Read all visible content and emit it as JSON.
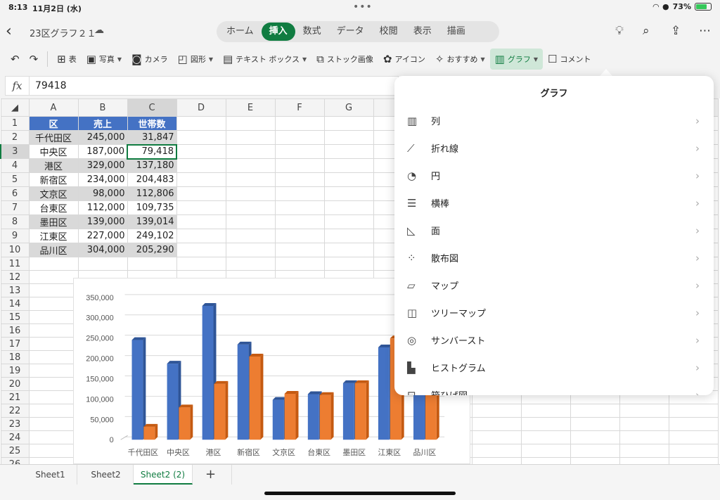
{
  "status": {
    "time": "8:13",
    "date": "11月2日 (水)",
    "battery": "73%",
    "battery_level": 0.73
  },
  "title": {
    "doc": "23区グラフ２１"
  },
  "tabs": [
    "ホーム",
    "挿入",
    "数式",
    "データ",
    "校閲",
    "表示",
    "描画"
  ],
  "active_tab": 1,
  "ribbon": {
    "table": "表",
    "photo": "写真",
    "camera": "カメラ",
    "shapes": "図形",
    "textbox": "テキスト ボックス",
    "stock": "ストック画像",
    "icon": "アイコン",
    "recommend": "おすすめ",
    "chart": "グラフ",
    "comment": "コメント"
  },
  "formula": {
    "fx": "fx",
    "value": "79418"
  },
  "columns": [
    "A",
    "B",
    "C",
    "D",
    "E",
    "F",
    "G"
  ],
  "headers": [
    "区",
    "売上",
    "世帯数"
  ],
  "rows": [
    [
      "千代田区",
      "245,000",
      "31,847"
    ],
    [
      "中央区",
      "187,000",
      "79,418"
    ],
    [
      "港区",
      "329,000",
      "137,180"
    ],
    [
      "新宿区",
      "234,000",
      "204,483"
    ],
    [
      "文京区",
      "98,000",
      "112,806"
    ],
    [
      "台東区",
      "112,000",
      "109,735"
    ],
    [
      "墨田区",
      "139,000",
      "139,014"
    ],
    [
      "江東区",
      "227,000",
      "249,102"
    ],
    [
      "品川区",
      "304,000",
      "205,290"
    ]
  ],
  "row_numbers": [
    "1",
    "2",
    "3",
    "4",
    "5",
    "6",
    "7",
    "8",
    "9",
    "10",
    "11",
    "12",
    "13",
    "14",
    "15",
    "16",
    "17",
    "18",
    "19",
    "20",
    "21",
    "22",
    "23",
    "24",
    "25",
    "26"
  ],
  "chart_data": {
    "type": "bar",
    "categories": [
      "千代田区",
      "中央区",
      "港区",
      "新宿区",
      "文京区",
      "台東区",
      "墨田区",
      "江東区",
      "品川区"
    ],
    "series": [
      {
        "values": [
          245000,
          187000,
          329000,
          234000,
          98000,
          112000,
          139000,
          227000,
          304000
        ],
        "color": "#4472c4"
      },
      {
        "values": [
          31847,
          79418,
          137180,
          204483,
          112806,
          109735,
          139014,
          249102,
          205290
        ],
        "color": "#ed7d31"
      }
    ],
    "yticks": [
      "0",
      "50,000",
      "100,000",
      "150,000",
      "200,000",
      "250,000",
      "300,000",
      "350,000"
    ],
    "ylim": [
      0,
      350000
    ],
    "grid": true
  },
  "dropdown": {
    "title": "グラフ",
    "items": [
      {
        "label": "列",
        "icon": "column-chart-icon",
        "glyph": "▥"
      },
      {
        "label": "折れ線",
        "icon": "line-chart-icon",
        "glyph": "⟋"
      },
      {
        "label": "円",
        "icon": "pie-chart-icon",
        "glyph": "◔"
      },
      {
        "label": "横棒",
        "icon": "bar-chart-icon",
        "glyph": "☰"
      },
      {
        "label": "面",
        "icon": "area-chart-icon",
        "glyph": "◺"
      },
      {
        "label": "散布図",
        "icon": "scatter-chart-icon",
        "glyph": "⁘"
      },
      {
        "label": "マップ",
        "icon": "map-icon",
        "glyph": "▱"
      },
      {
        "label": "ツリーマップ",
        "icon": "treemap-icon",
        "glyph": "◫"
      },
      {
        "label": "サンバースト",
        "icon": "sunburst-icon",
        "glyph": "◎"
      },
      {
        "label": "ヒストグラム",
        "icon": "histogram-icon",
        "glyph": "▙"
      },
      {
        "label": "箱ひげ図",
        "icon": "boxplot-icon",
        "glyph": "⊟"
      }
    ]
  },
  "sheets": [
    "Sheet1",
    "Sheet2",
    "Sheet2 (2)"
  ],
  "active_sheet": 2,
  "accent": "#107c41"
}
